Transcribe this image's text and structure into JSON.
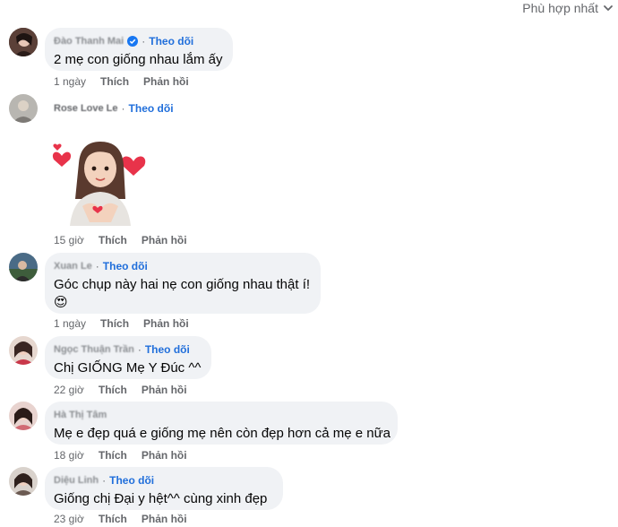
{
  "sort_label": "Phù hợp nhất",
  "follow_label": "Theo dõi",
  "like_label": "Thích",
  "reply_label": "Phản hồi",
  "comments": [
    {
      "name": "Đào Thanh Mai",
      "text": "2 mẹ con giống nhau lắm ấy",
      "time": "1 ngày",
      "verified": true
    },
    {
      "name": "Rose Love Le",
      "text": "",
      "time": "15 giờ",
      "sticker": "heart-girl-sticker"
    },
    {
      "name": "Xuan Le",
      "text": "Góc chụp này hai nẹ con giống nhau thật í!",
      "emoji": "😍",
      "time": "1 ngày"
    },
    {
      "name": "Ngọc Thuận Trần",
      "text": "Chị GIỐNG Mẹ Y Đúc ^^",
      "time": "22 giờ"
    },
    {
      "name": "Hà Thị Tâm",
      "text": "Mẹ e đẹp quá e giống mẹ nên còn đẹp hơn cả mẹ e nữa",
      "time": "18 giờ"
    },
    {
      "name": "Diệu Linh",
      "text": "Giống chị Đại y hệt^^ cùng xinh đẹp",
      "time": "23 giờ"
    }
  ],
  "colors": {
    "link": "#216fdb",
    "bubble": "#f0f2f5",
    "meta": "#65676b"
  }
}
